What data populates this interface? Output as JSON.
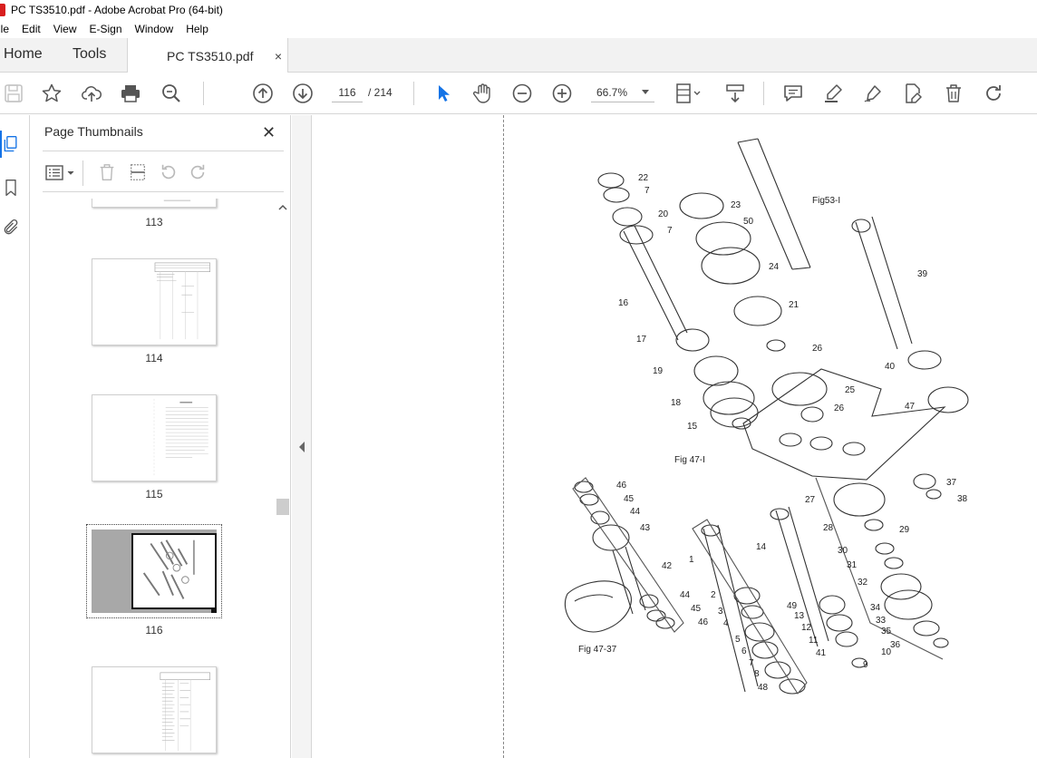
{
  "window": {
    "title": "PC TS3510.pdf - Adobe Acrobat Pro (64-bit)"
  },
  "menu": [
    "ile",
    "Edit",
    "View",
    "E-Sign",
    "Window",
    "Help"
  ],
  "tabs": {
    "home": "Home",
    "tools": "Tools",
    "document": "PC TS3510.pdf",
    "close": "×"
  },
  "toolbar": {
    "page_current": "116",
    "page_total": "/  214",
    "zoom": "66.7%",
    "icons": [
      "save-icon",
      "star-icon",
      "cloud-upload-icon",
      "print-icon",
      "zoom-search-icon",
      "page-up-icon",
      "page-down-icon",
      "select-arrow-icon",
      "hand-icon",
      "zoom-out-icon",
      "zoom-in-icon",
      "page-layout-icon",
      "scroll-mode-icon",
      "comment-icon",
      "highlight-icon",
      "sign-icon",
      "edit-pdf-icon",
      "delete-icon",
      "rotate-icon"
    ]
  },
  "panel": {
    "title": "Page Thumbnails",
    "close": "✕",
    "thumbnails": [
      {
        "number": "113"
      },
      {
        "number": "114"
      },
      {
        "number": "115"
      },
      {
        "number": "116",
        "selected": true
      },
      {
        "number": ""
      }
    ]
  },
  "diagram": {
    "labels": [
      "22",
      "7",
      "20",
      "7",
      "23",
      "50",
      "24",
      "21",
      "26",
      "25",
      "26",
      "16",
      "17",
      "19",
      "18",
      "15",
      "39",
      "40",
      "47",
      "37",
      "38",
      "Fig53-I",
      "Fig 47-I",
      "46",
      "45",
      "44",
      "43",
      "42",
      "44",
      "45",
      "46",
      "Fig 47-37",
      "1",
      "2",
      "3",
      "4",
      "5",
      "6",
      "7",
      "8",
      "48",
      "14",
      "49",
      "13",
      "12",
      "11",
      "41",
      "9",
      "27",
      "28",
      "29",
      "30",
      "31",
      "32",
      "34",
      "33",
      "35",
      "36",
      "10"
    ]
  },
  "colors": {
    "accent": "#1473e6",
    "select_arrow": "#1473e6"
  }
}
